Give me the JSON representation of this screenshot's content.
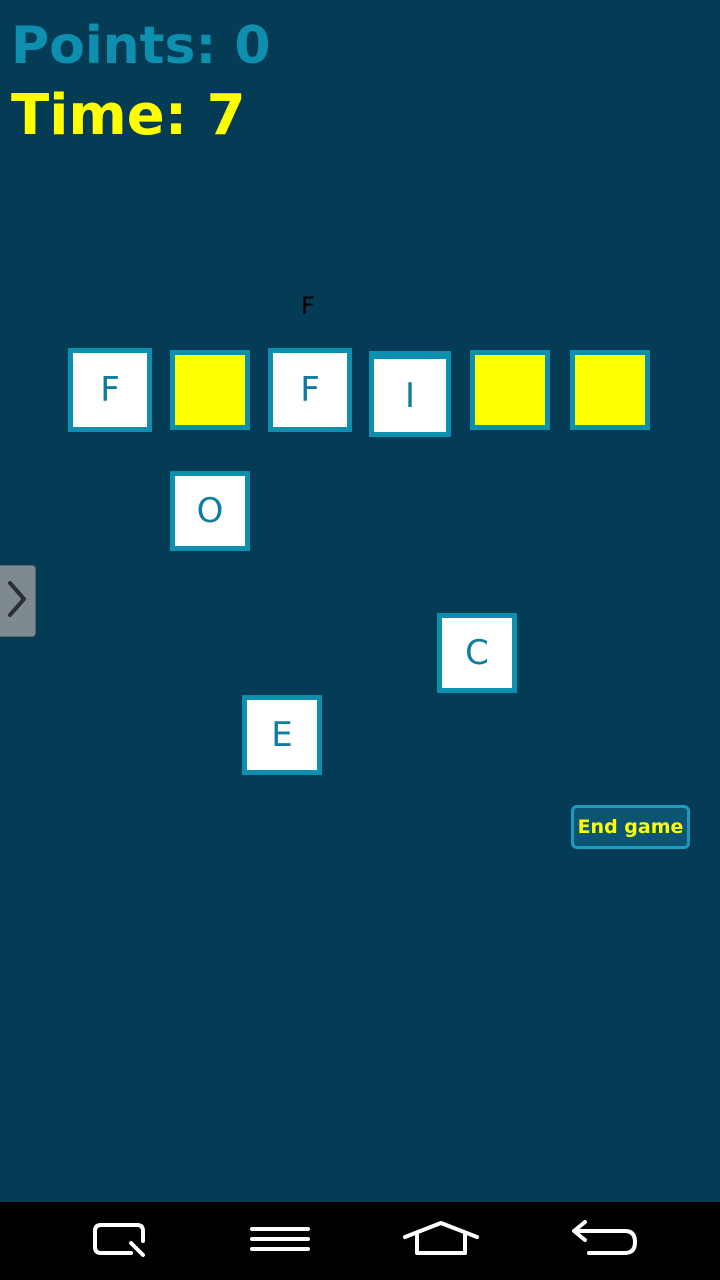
{
  "hud": {
    "points_text": "Points: 0",
    "time_text": "Time: 7"
  },
  "hint": "F",
  "word_slots": [
    "F",
    "",
    "F",
    "I",
    "",
    ""
  ],
  "letter_tiles": [
    {
      "letter": "O"
    },
    {
      "letter": "C"
    },
    {
      "letter": "E"
    }
  ],
  "end_button": "End game",
  "colors": {
    "background": "#053c55",
    "accent": "#0e8fb0",
    "empty_slot": "#ffff00",
    "time": "#ffff00"
  },
  "icons": {
    "side_handle": "chevron-right-icon",
    "nav": [
      "recent-apps-icon",
      "menu-icon",
      "home-icon",
      "back-icon"
    ]
  }
}
